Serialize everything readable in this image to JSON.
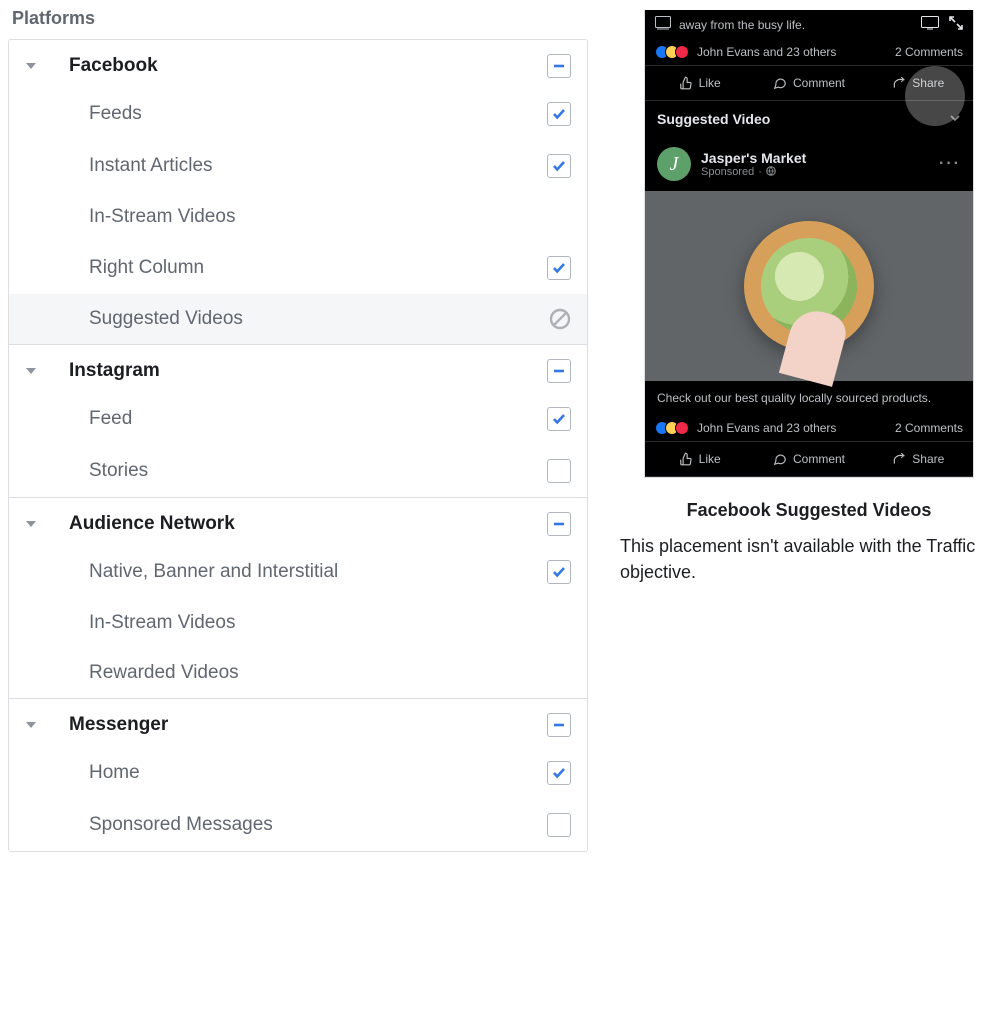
{
  "section_title": "Platforms",
  "groups": [
    {
      "key": "facebook",
      "label": "Facebook",
      "state": "indeterminate",
      "items": [
        {
          "key": "feeds",
          "label": "Feeds",
          "state": "checked"
        },
        {
          "key": "instant-articles",
          "label": "Instant Articles",
          "state": "checked"
        },
        {
          "key": "in-stream-videos",
          "label": "In-Stream Videos",
          "state": "none"
        },
        {
          "key": "right-column",
          "label": "Right Column",
          "state": "checked"
        },
        {
          "key": "suggested-videos",
          "label": "Suggested Videos",
          "state": "unavailable",
          "highlighted": true
        }
      ]
    },
    {
      "key": "instagram",
      "label": "Instagram",
      "state": "indeterminate",
      "items": [
        {
          "key": "feed",
          "label": "Feed",
          "state": "checked"
        },
        {
          "key": "stories",
          "label": "Stories",
          "state": "unchecked"
        }
      ]
    },
    {
      "key": "audience-network",
      "label": "Audience Network",
      "state": "indeterminate",
      "items": [
        {
          "key": "native-banner-interstitial",
          "label": "Native, Banner and Interstitial",
          "state": "checked"
        },
        {
          "key": "an-in-stream-videos",
          "label": "In-Stream Videos",
          "state": "none"
        },
        {
          "key": "rewarded-videos",
          "label": "Rewarded Videos",
          "state": "none"
        }
      ]
    },
    {
      "key": "messenger",
      "label": "Messenger",
      "state": "indeterminate",
      "items": [
        {
          "key": "home",
          "label": "Home",
          "state": "checked"
        },
        {
          "key": "sponsored-messages",
          "label": "Sponsored Messages",
          "state": "unchecked"
        }
      ]
    }
  ],
  "preview": {
    "title": "Facebook Suggested Videos",
    "description": "This placement isn't available with the Traffic objective.",
    "prev_post_text": "away from the busy life.",
    "engagement_text": "John Evans and 23 others",
    "comments_text": "2 Comments",
    "actions": {
      "like": "Like",
      "comment": "Comment",
      "share": "Share"
    },
    "section_header": "Suggested Video",
    "post": {
      "author": "Jasper's Market",
      "meta": "Sponsored",
      "caption": "Check out our best quality locally sourced products."
    }
  }
}
